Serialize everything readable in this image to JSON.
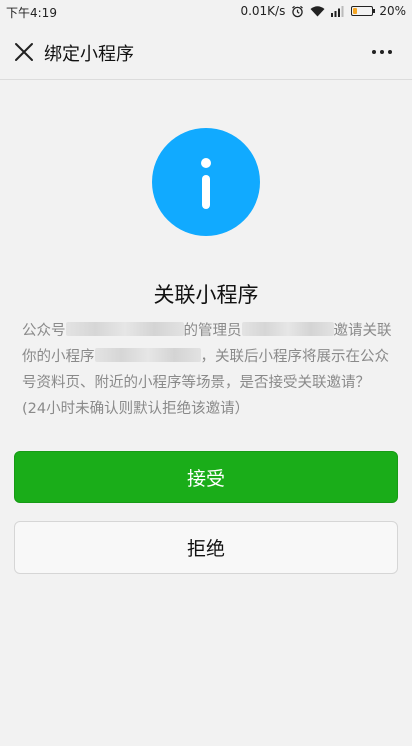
{
  "status_bar": {
    "time": "下午4:19",
    "network_speed": "0.01K/s",
    "alarm_icon": "alarm-clock-icon",
    "wifi_icon": "wifi-icon",
    "signal_icon": "signal-bars-icon",
    "battery_percent": "20%",
    "battery_level": 0.2,
    "battery_color": "#f5a623"
  },
  "title_bar": {
    "title": "绑定小程序",
    "close_icon": "close-icon",
    "more_icon": "more-dots-icon"
  },
  "content": {
    "info_icon": "info-icon",
    "icon_color": "#11aaff",
    "heading": "关联小程序",
    "description": {
      "part1": "公众号",
      "part2": "的管理员",
      "part3": "邀请关联你的小程序",
      "part4": "，关联后小程序将展示在公众号资料页、附近的小程序等场景，是否接受关联邀请？(24小时未确认则默认拒绝该邀请）"
    }
  },
  "actions": {
    "accept_label": "接受",
    "accept_color": "#1aad19",
    "reject_label": "拒绝"
  }
}
